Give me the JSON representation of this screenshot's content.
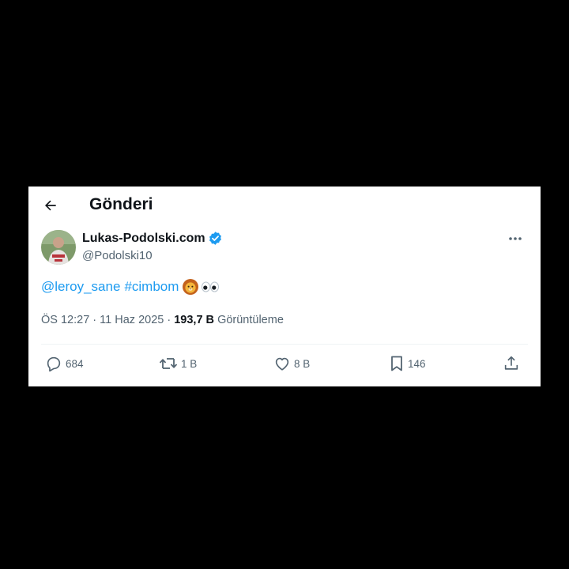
{
  "header": {
    "title": "Gönderi",
    "back_icon": "arrow-left-icon"
  },
  "author": {
    "display_name": "Lukas-Podolski.com",
    "handle": "@Podolski10",
    "verified_color": "#1d9bf0"
  },
  "tweet": {
    "mention": "@leroy_sane",
    "hashtag": "#cimbom",
    "emojis": [
      "lion-face-icon",
      "eyes-icon"
    ],
    "link_color": "#1d9bf0"
  },
  "meta": {
    "time": "ÖS 12:27",
    "separator": "·",
    "date": "11 Haz 2025",
    "views_count": "193,7 B",
    "views_label": "Görüntüleme"
  },
  "actions": {
    "reply_count": "684",
    "retweet_count": "1 B",
    "like_count": "8 B",
    "bookmark_count": "146"
  },
  "colors": {
    "page_background": "#000000",
    "card_background": "#ffffff",
    "text_primary": "#0f1419",
    "text_secondary": "#536471"
  }
}
